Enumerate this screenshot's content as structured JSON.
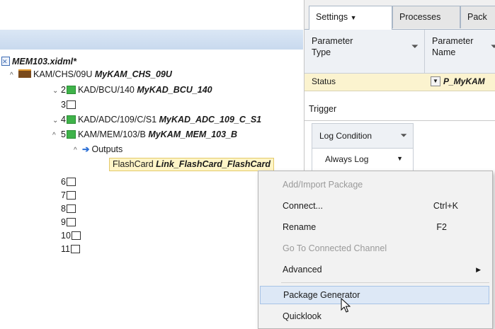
{
  "tree": {
    "file": {
      "name": "MEM103.xidml*"
    },
    "chassis": {
      "path": "KAM/CHS/09U",
      "name": "MyKAM_CHS_09U"
    },
    "slots": [
      {
        "slot": "2",
        "path": "KAD/BCU/140",
        "name": "MyKAD_BCU_140"
      },
      {
        "slot": "3"
      },
      {
        "slot": "4",
        "path": "KAD/ADC/109/C/S1",
        "name": "MyKAD_ADC_109_C_S1"
      },
      {
        "slot": "5",
        "path": "KAM/MEM/103/B",
        "name": "MyKAM_MEM_103_B"
      },
      {
        "slot": "6"
      },
      {
        "slot": "7"
      },
      {
        "slot": "8"
      },
      {
        "slot": "9"
      },
      {
        "slot": "10"
      },
      {
        "slot": "11"
      }
    ],
    "outputs_label": "Outputs",
    "flash": {
      "label": "FlashCard",
      "name": "Link_FlashCard_FlashCard"
    }
  },
  "right": {
    "tabs": [
      "Settings",
      "Processes",
      "Pack"
    ],
    "table": {
      "col1": [
        "Parameter",
        "Type"
      ],
      "col2": [
        "Parameter",
        "Name"
      ],
      "status_type": "Status",
      "status_name": "P_MyKAM"
    },
    "trigger_label": "Trigger",
    "log_condition_header": "Log Condition",
    "log_condition_value": "Always Log"
  },
  "menu": {
    "items": [
      {
        "label": "Add/Import Package",
        "shortcut": "",
        "enabled": false
      },
      {
        "label": "Connect...",
        "shortcut": "Ctrl+K",
        "enabled": true
      },
      {
        "label": "Rename",
        "shortcut": "F2",
        "enabled": true
      },
      {
        "label": "Go To Connected Channel",
        "shortcut": "",
        "enabled": false
      },
      {
        "label": "Advanced",
        "shortcut": "",
        "enabled": true
      },
      {
        "label": "Package Generator",
        "shortcut": "",
        "enabled": true
      },
      {
        "label": "Quicklook",
        "shortcut": "",
        "enabled": true
      }
    ]
  }
}
